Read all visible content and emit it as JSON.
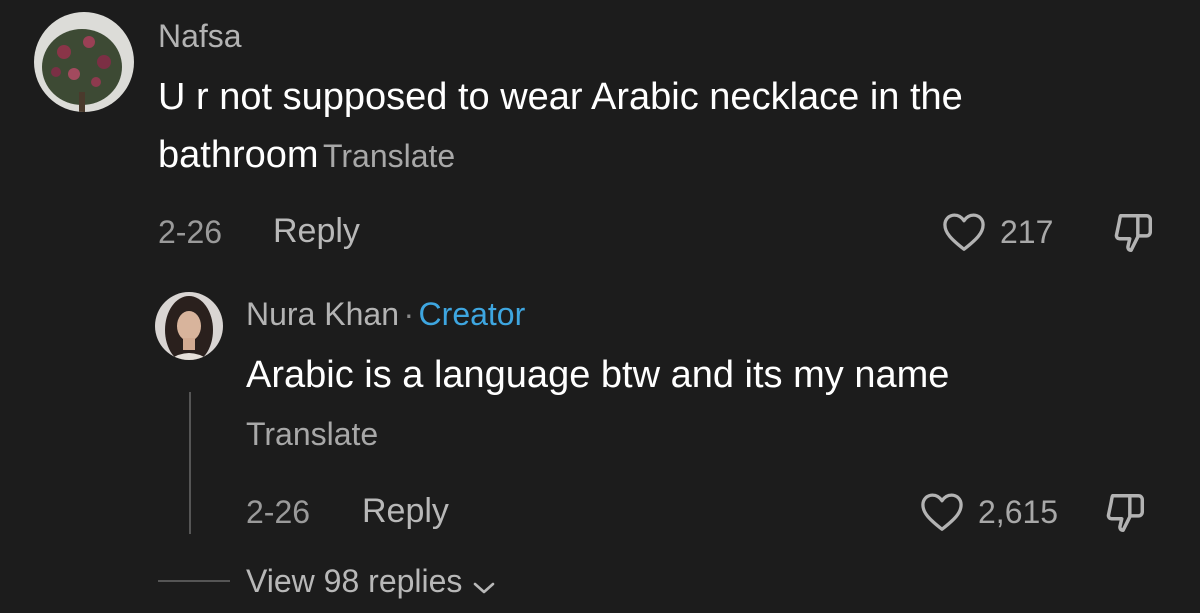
{
  "comment": {
    "username": "Nafsa",
    "text_line1": "U r not supposed to wear Arabic necklace in the",
    "text_line2": "bathroom",
    "translate_label": "Translate",
    "date": "2-26",
    "reply_label": "Reply",
    "like_count": "217",
    "like_icon": "heart-outline-icon",
    "dislike_icon": "thumbs-down-icon"
  },
  "reply": {
    "username": "Nura Khan",
    "separator": "·",
    "badge": "Creator",
    "text": "Arabic is a language btw and its my name",
    "translate_label": "Translate",
    "date": "2-26",
    "reply_label": "Reply",
    "like_count": "2,615",
    "like_icon": "heart-outline-icon",
    "dislike_icon": "thumbs-down-icon"
  },
  "view_replies_label": "View 98 replies",
  "colors": {
    "background": "#1c1c1c",
    "creator_badge": "#3ea6e0",
    "secondary_text": "#a8a8a8"
  }
}
